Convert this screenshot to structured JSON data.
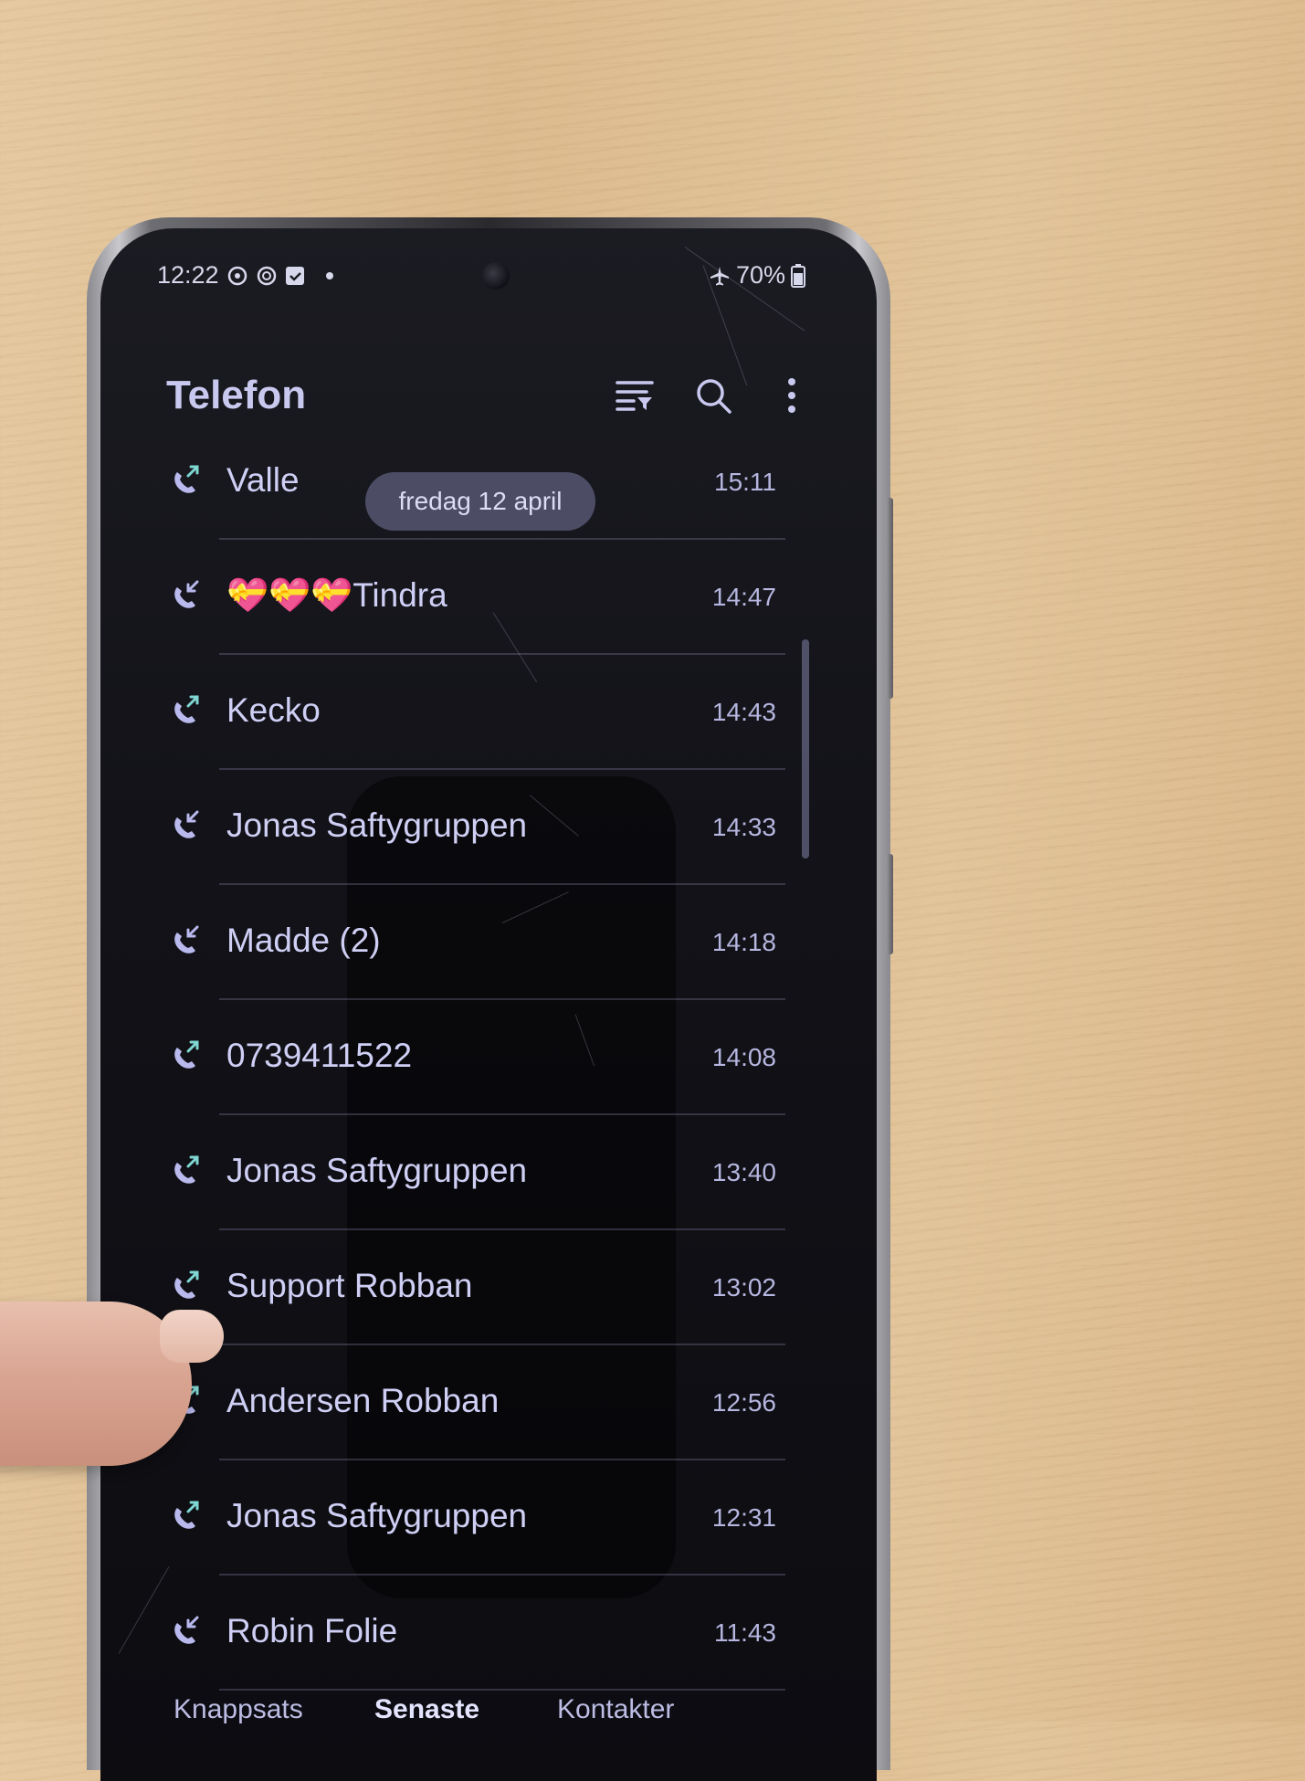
{
  "status_bar": {
    "time": "12:22",
    "battery": "70%"
  },
  "app": {
    "title": "Telefon"
  },
  "icons": {
    "filter": "filter-icon",
    "search": "search-icon",
    "more": "more-vertical-icon",
    "outgoing": "outgoing-call-icon",
    "incoming": "incoming-call-icon",
    "airplane": "airplane-icon",
    "battery": "battery-icon"
  },
  "date_header": "fredag 12 april",
  "calls": [
    {
      "name": "Valle",
      "time": "15:11",
      "type": "outgoing"
    },
    {
      "name": "💝💝💝Tindra",
      "time": "14:47",
      "type": "incoming"
    },
    {
      "name": "Kecko",
      "time": "14:43",
      "type": "outgoing"
    },
    {
      "name": "Jonas Saftygruppen",
      "time": "14:33",
      "type": "incoming"
    },
    {
      "name": "Madde (2)",
      "time": "14:18",
      "type": "incoming"
    },
    {
      "name": "0739411522",
      "time": "14:08",
      "type": "outgoing"
    },
    {
      "name": "Jonas Saftygruppen",
      "time": "13:40",
      "type": "outgoing"
    },
    {
      "name": "Support Robban",
      "time": "13:02",
      "type": "outgoing"
    },
    {
      "name": "Andersen Robban",
      "time": "12:56",
      "type": "outgoing"
    },
    {
      "name": "Jonas Saftygruppen",
      "time": "12:31",
      "type": "outgoing"
    },
    {
      "name": "Robin Folie",
      "time": "11:43",
      "type": "incoming"
    }
  ],
  "bottom_nav": {
    "tabs": [
      "Knappsats",
      "Senaste",
      "Kontakter"
    ],
    "active": "Senaste"
  },
  "colors": {
    "outgoing": "#7fd6d2",
    "incoming": "#b9b9ee",
    "text": "#cfcff5"
  }
}
